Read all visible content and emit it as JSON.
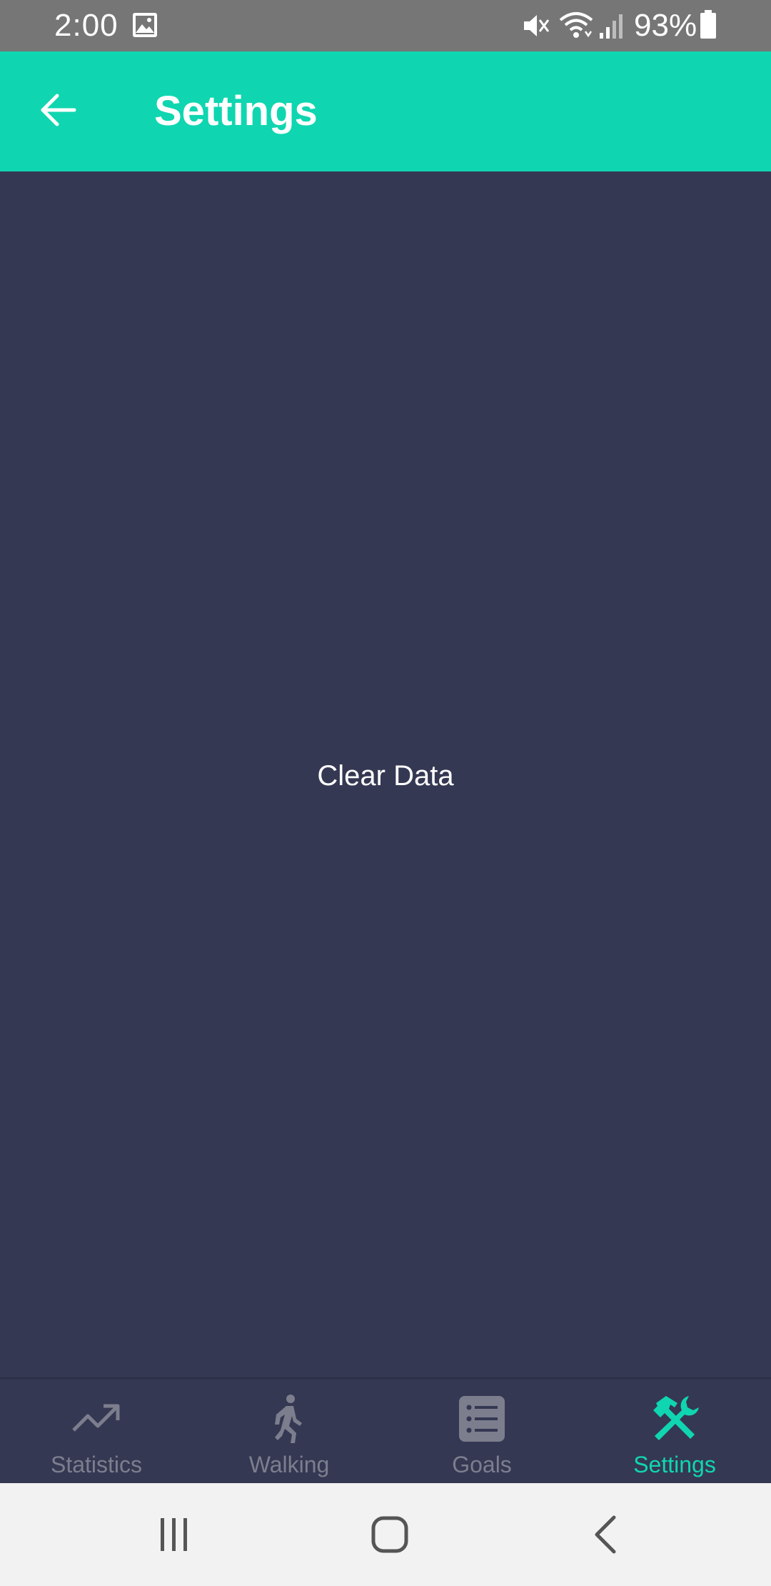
{
  "status_bar": {
    "time": "2:00",
    "battery_percent": "93%",
    "icons": [
      "image-icon",
      "mute-icon",
      "wifi-icon",
      "signal-icon",
      "battery-icon"
    ]
  },
  "app_bar": {
    "title": "Settings",
    "back_icon": "arrow-left-icon"
  },
  "main": {
    "clear_data_label": "Clear Data"
  },
  "bottom_nav": {
    "items": [
      {
        "label": "Statistics",
        "icon": "trending-up-icon",
        "active": false
      },
      {
        "label": "Walking",
        "icon": "walking-icon",
        "active": false
      },
      {
        "label": "Goals",
        "icon": "list-icon",
        "active": false
      },
      {
        "label": "Settings",
        "icon": "tools-icon",
        "active": true
      }
    ]
  },
  "system_nav": {
    "icons": [
      "recents-icon",
      "home-icon",
      "back-icon"
    ]
  },
  "colors": {
    "accent": "#0fd6b0",
    "background": "#353852",
    "status_bar": "#767676",
    "inactive": "#7c7e8e",
    "system_nav": "#f2f2f2"
  }
}
